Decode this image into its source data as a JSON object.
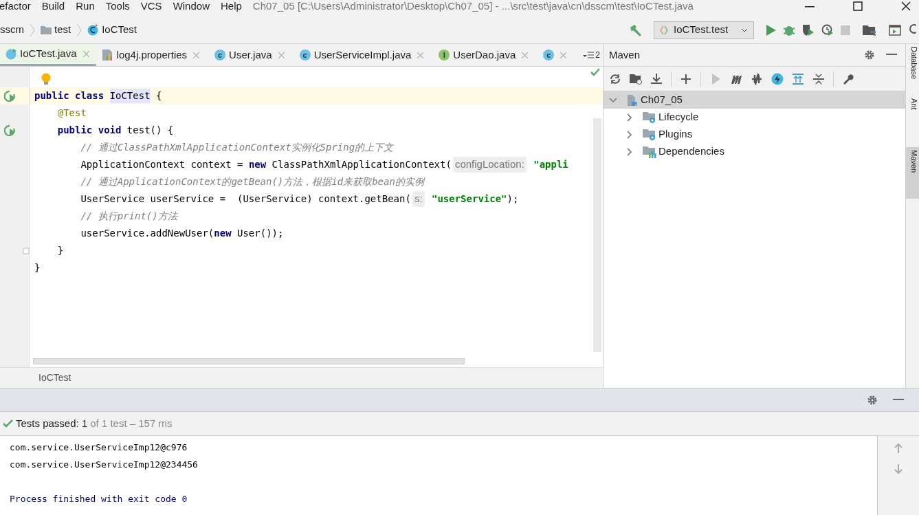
{
  "menu": [
    "efactor",
    "Build",
    "Run",
    "Tools",
    "VCS",
    "Window",
    "Help"
  ],
  "window": {
    "title": "Ch07_05 [C:\\Users\\Administrator\\Desktop\\Ch07_05] - ...\\src\\test\\java\\cn\\dsscm\\test\\IoCTest.java"
  },
  "breadcrumb": [
    {
      "kind": "text",
      "label": "sscm"
    },
    {
      "kind": "folder",
      "label": "test"
    },
    {
      "kind": "class",
      "label": "IoCTest"
    }
  ],
  "run_config": {
    "label": "IoCTest.test"
  },
  "tabs": [
    {
      "kind": "test",
      "label": "IoCTest.java",
      "selected": true
    },
    {
      "kind": "properties",
      "label": "log4j.properties",
      "selected": false
    },
    {
      "kind": "class",
      "glyph": "c",
      "label": "User.java",
      "selected": false
    },
    {
      "kind": "class",
      "glyph": "c",
      "label": "UserServiceImpl.java",
      "selected": false
    },
    {
      "kind": "interface",
      "glyph": "I",
      "label": "UserDao.java",
      "selected": false
    },
    {
      "kind": "class",
      "glyph": "c",
      "selected": false
    }
  ],
  "tab_overflow": {
    "count": "2"
  },
  "code_lines": [
    {
      "kind": "bulb",
      "current": false
    },
    {
      "kind": "run",
      "current": true,
      "tokens": [
        {
          "kind": "keyword",
          "text": "public class "
        },
        {
          "kind": "highlight",
          "text": "IoCTest"
        },
        {
          "kind": "plain",
          "text": " {"
        }
      ]
    },
    {
      "kind": "plain",
      "current": false,
      "tokens": [
        {
          "kind": "annotation",
          "text": "    @Test"
        }
      ]
    },
    {
      "kind": "run",
      "current": false,
      "tokens": [
        {
          "kind": "keyword",
          "text": "    public void "
        },
        {
          "kind": "plain",
          "text": "test() {"
        }
      ]
    },
    {
      "kind": "plain",
      "current": false,
      "tokens": [
        {
          "kind": "comment",
          "text": "        // 通过ClassPathXmlApplicationContext实例化Spring的上下文"
        }
      ]
    },
    {
      "kind": "plain",
      "current": false,
      "tokens": [
        {
          "kind": "plain",
          "text": "        ApplicationContext context = "
        },
        {
          "kind": "keyword",
          "text": "new "
        },
        {
          "kind": "plain",
          "text": "ClassPathXmlApplicationContext("
        },
        {
          "kind": "hint",
          "text": "configLocation:"
        },
        {
          "kind": "string",
          "text": " \"appli"
        }
      ]
    },
    {
      "kind": "plain",
      "current": false,
      "tokens": [
        {
          "kind": "comment",
          "text": "        // 通过ApplicationContext的getBean()方法，根据id来获取bean的实例"
        }
      ]
    },
    {
      "kind": "plain",
      "current": false,
      "tokens": [
        {
          "kind": "plain",
          "text": "        UserService userService =  (UserService) context.getBean("
        },
        {
          "kind": "hint",
          "text": "s:"
        },
        {
          "kind": "string",
          "text": " \"userService\""
        },
        {
          "kind": "plain",
          "text": ");"
        }
      ]
    },
    {
      "kind": "plain",
      "current": false,
      "tokens": [
        {
          "kind": "comment",
          "text": "        // 执行print()方法"
        }
      ]
    },
    {
      "kind": "plain",
      "current": false,
      "tokens": [
        {
          "kind": "plain",
          "text": "        userService.addNewUser("
        },
        {
          "kind": "keyword",
          "text": "new "
        },
        {
          "kind": "plain",
          "text": "User());"
        }
      ]
    },
    {
      "kind": "fold",
      "current": false,
      "tokens": [
        {
          "kind": "plain",
          "text": "    }"
        }
      ]
    },
    {
      "kind": "plain",
      "current": false,
      "tokens": [
        {
          "kind": "plain",
          "text": "}"
        }
      ]
    }
  ],
  "editor_breadcrumb": "IoCTest",
  "maven": {
    "title": "Maven",
    "tree": [
      {
        "label": "Ch07_05",
        "kind": "project",
        "expanded": true,
        "selected": true,
        "children": [
          {
            "label": "Lifecycle",
            "kind": "gear-folder",
            "expanded": false,
            "selected": false
          },
          {
            "label": "Plugins",
            "kind": "gear-folder",
            "expanded": false,
            "selected": false
          },
          {
            "label": "Dependencies",
            "kind": "chart-folder",
            "expanded": false,
            "selected": false
          }
        ]
      }
    ]
  },
  "side_tabs": [
    {
      "label": "Database",
      "selected": false
    },
    {
      "label": "Ant",
      "selected": false
    },
    {
      "label": "Maven",
      "selected": true
    }
  ],
  "run_panel": {
    "status": "Tests passed: 1",
    "status_detail": "of 1 test – 157 ms",
    "console": [
      {
        "kind": "output",
        "text": "com.service.UserServiceImp12@c976"
      },
      {
        "kind": "output",
        "text": "com.service.UserServiceImp12@234456"
      },
      {
        "kind": "blank"
      },
      {
        "kind": "system",
        "text": "Process finished with exit code 0"
      }
    ]
  }
}
